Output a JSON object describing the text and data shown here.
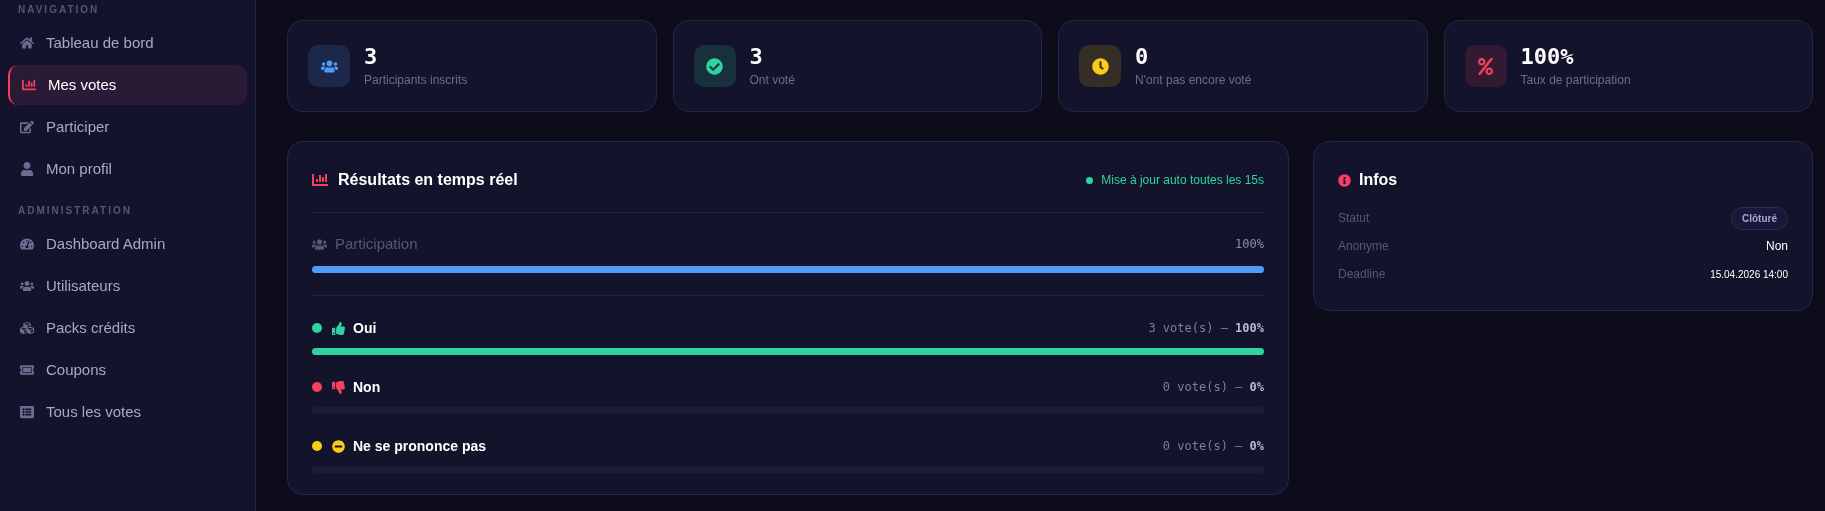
{
  "sidebar": {
    "sections": [
      {
        "title": "NAVIGATION",
        "items": [
          {
            "label": "Tableau de bord",
            "selected": false
          },
          {
            "label": "Mes votes",
            "selected": true
          },
          {
            "label": "Participer",
            "selected": false
          },
          {
            "label": "Mon profil",
            "selected": false
          }
        ]
      },
      {
        "title": "ADMINISTRATION",
        "items": [
          {
            "label": "Dashboard Admin",
            "selected": false
          },
          {
            "label": "Utilisateurs",
            "selected": false
          },
          {
            "label": "Packs crédits",
            "selected": false
          },
          {
            "label": "Coupons",
            "selected": false
          },
          {
            "label": "Tous les votes",
            "selected": false
          }
        ]
      }
    ]
  },
  "stats": [
    {
      "value": "3",
      "label": "Participants inscrits",
      "color": "#4f9cf9"
    },
    {
      "value": "3",
      "label": "Ont voté",
      "color": "#2dd4a0"
    },
    {
      "value": "0",
      "label": "N'ont pas encore voté",
      "color": "#facc15"
    },
    {
      "value": "100%",
      "label": "Taux de participation",
      "color": "#f43f5e"
    }
  ],
  "results": {
    "title": "Résultats en temps réel",
    "auto_update": "Mise à jour auto toutes les 15s",
    "participation": {
      "label": "Participation",
      "reading": "100%",
      "level": 1
    },
    "options": [
      {
        "label": "Oui",
        "reading": "3 vote(s) — **100%**",
        "level": 1,
        "color": "#2dd4a0"
      },
      {
        "label": "Non",
        "reading": "0 vote(s) — **0%**",
        "level": 0,
        "color": "#f43f5e"
      },
      {
        "label": "Ne se prononce pas",
        "reading": "0 vote(s) — **0%**",
        "level": 0,
        "color": "#facc15"
      }
    ]
  },
  "infos": {
    "title": "Infos",
    "rows": [
      {
        "kind": "badge",
        "label": "Statut",
        "value": "Clôturé"
      },
      {
        "kind": "text",
        "label": "Anonyme",
        "value": "Non"
      },
      {
        "kind": "small",
        "label": "Deadline",
        "value": "15.04.2026 14:00"
      }
    ]
  }
}
